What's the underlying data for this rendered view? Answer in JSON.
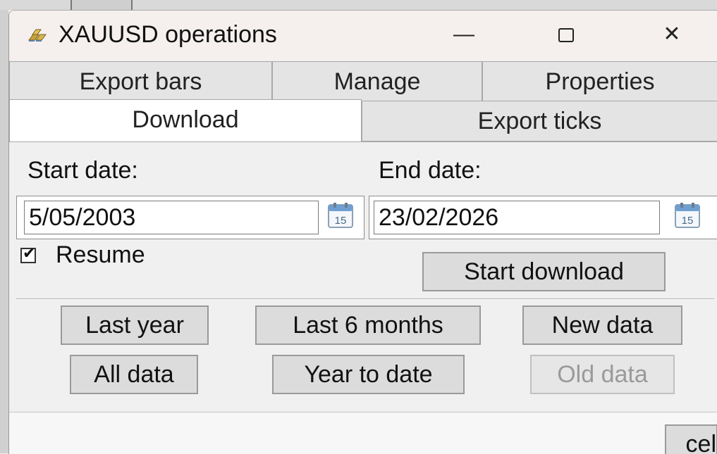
{
  "window": {
    "title": "XAUUSD operations",
    "app_icon": "gold-bars-icon",
    "controls": {
      "minimize": "—",
      "close": "✕"
    }
  },
  "tabs": {
    "row1": [
      {
        "label": "Export bars"
      },
      {
        "label": "Manage"
      },
      {
        "label": "Properties"
      }
    ],
    "row2": [
      {
        "label": "Download",
        "selected": true
      },
      {
        "label": "Export ticks"
      }
    ]
  },
  "download": {
    "start_label": "Start date:",
    "end_label": "End date:",
    "start_value": "5/05/2003",
    "end_value": "23/02/2026",
    "calendar_icon": "calendar-icon",
    "calendar_day": "15",
    "resume_label": "Resume",
    "resume_checked": true,
    "start_download_label": "Start download",
    "presets": {
      "last_year": "Last year",
      "last_6_months": "Last 6 months",
      "new_data": "New data",
      "all_data": "All data",
      "year_to_date": "Year to date",
      "old_data": "Old data"
    }
  },
  "footer": {
    "cancel_label": "cel"
  },
  "colors": {
    "accent": "#4a7fc1",
    "window_bg": "#f0f0f0",
    "title_bg": "#f5f0ee",
    "disabled_text": "#9a9a9a"
  }
}
